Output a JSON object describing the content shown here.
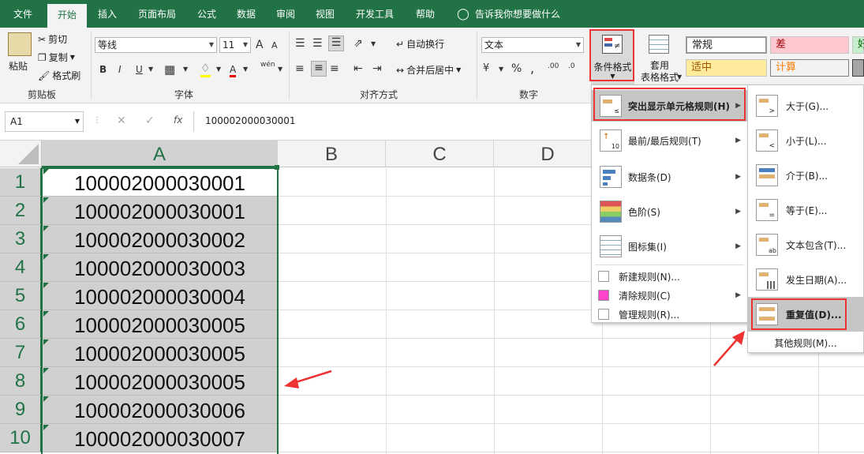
{
  "tabs": [
    "文件",
    "开始",
    "插入",
    "页面布局",
    "公式",
    "数据",
    "审阅",
    "视图",
    "开发工具",
    "帮助"
  ],
  "tell_me": "告诉我你想要做什么",
  "ribbon": {
    "clipboard": {
      "paste": "粘贴",
      "cut": "剪切",
      "copy": "复制",
      "format_painter": "格式刷",
      "label": "剪贴板"
    },
    "font": {
      "name": "等线",
      "size": "11",
      "label": "字体",
      "bold": "B",
      "italic": "I",
      "underline": "U",
      "grow": "A",
      "shrink": "A",
      "wen": "wén"
    },
    "alignment": {
      "wrap": "自动换行",
      "merge": "合并后居中",
      "label": "对齐方式"
    },
    "number": {
      "format": "文本",
      "label": "数字",
      "percent": "%",
      "comma": ","
    },
    "conditional_format": "条件格式",
    "table_format": "套用\n表格格式",
    "styles": {
      "normal": "常规",
      "bad": "差",
      "good": "好",
      "neutral": "适中",
      "calc": "计算"
    }
  },
  "formula_bar": {
    "namebox": "A1",
    "value": "100002000030001",
    "fx": "fx"
  },
  "columns": [
    "A",
    "B",
    "C",
    "D"
  ],
  "rows": [
    {
      "n": "1",
      "v": "100002000030001"
    },
    {
      "n": "2",
      "v": "100002000030001"
    },
    {
      "n": "3",
      "v": "100002000030002"
    },
    {
      "n": "4",
      "v": "100002000030003"
    },
    {
      "n": "5",
      "v": "100002000030004"
    },
    {
      "n": "6",
      "v": "100002000030005"
    },
    {
      "n": "7",
      "v": "100002000030005"
    },
    {
      "n": "8",
      "v": "100002000030005"
    },
    {
      "n": "9",
      "v": "100002000030006"
    },
    {
      "n": "10",
      "v": "100002000030007"
    }
  ],
  "menu": {
    "items": [
      "突出显示单元格规则(H)",
      "最前/最后规则(T)",
      "数据条(D)",
      "色阶(S)",
      "图标集(I)"
    ],
    "small": [
      "新建规则(N)...",
      "清除规则(C)",
      "管理规则(R)..."
    ]
  },
  "submenu": {
    "items": [
      "大于(G)...",
      "小于(L)...",
      "介于(B)...",
      "等于(E)...",
      "文本包含(T)...",
      "发生日期(A)...",
      "重复值(D)..."
    ],
    "other": "其他规则(M)..."
  },
  "colors": {
    "excel_green": "#217346",
    "highlight_red": "#e33"
  }
}
